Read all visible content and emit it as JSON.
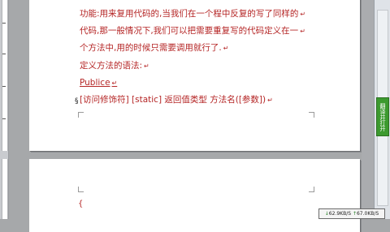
{
  "document": {
    "lines": [
      "功能:用来复用代码的,当我们在一个程中反复的写了同样的",
      "代码,那一般情况下,我们可以把需要重复写的代码定义在一",
      "个方法中,用的时候只需要调用就行了.",
      "定义方法的语法:",
      "Publice",
      "[访问修饰符] [static]  返回值类型   方法名([参数])"
    ],
    "paragraph_marks": [
      "↵",
      "↵",
      "↵",
      "↵",
      "↵",
      "↵"
    ],
    "page2_text": "{",
    "cursor_line_mark": "§"
  },
  "sidebar": {
    "green_tab_label": "翻译并打开"
  },
  "net_speed": {
    "down": "62.9KB/S",
    "up": "67.0KB/S",
    "down_arrow": "↓",
    "up_arrow": "↑"
  },
  "colors": {
    "text": "#b52626",
    "background": "#a6a8aa",
    "green_tab": "#3c9a2f"
  }
}
